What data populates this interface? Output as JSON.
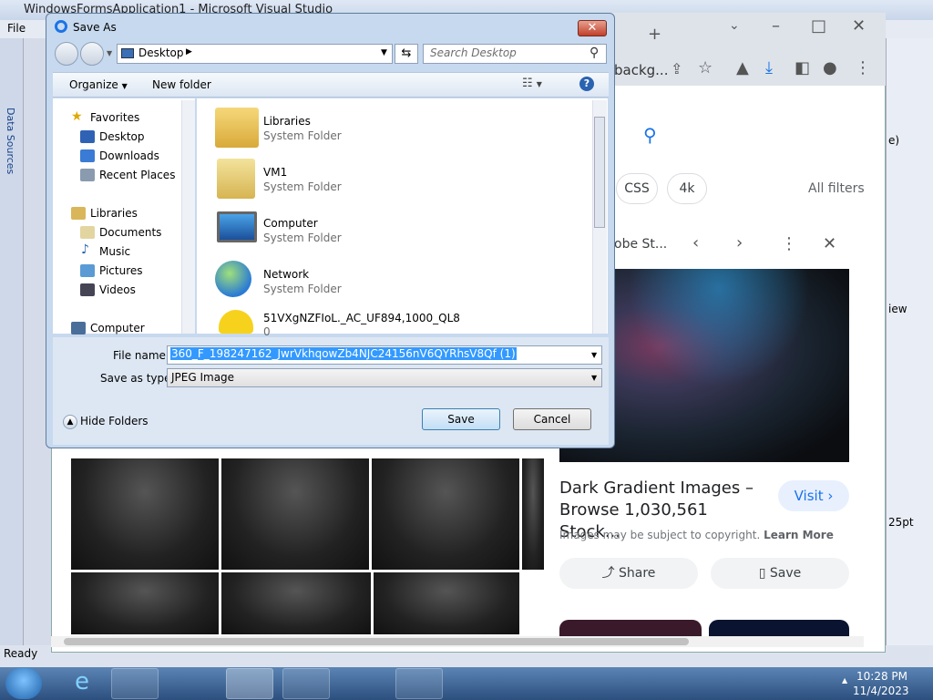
{
  "vs": {
    "title": "WindowsFormsApplication1 - Microsoft Visual Studio",
    "menu_file": "File",
    "data_sources": "Data Sources",
    "status": "Ready",
    "right_view": "iew",
    "right_pt": "25pt",
    "right_paren": "e)"
  },
  "chrome": {
    "tab_plus": "+",
    "addr_frag": "backg...",
    "chips": [
      "CSS",
      "4k"
    ],
    "all_filters": "All filters",
    "panel_source": "obe St...",
    "result_title": "Dark Gradient Images – Browse 1,030,561 Stock...",
    "copyright": "Images may be subject to copyright.",
    "learn_more": "Learn More",
    "visit": "Visit",
    "share": "Share",
    "save": "Save"
  },
  "dialog": {
    "title": "Save As",
    "address": "Desktop",
    "search_placeholder": "Search Desktop",
    "organize": "Organize",
    "new_folder": "New folder",
    "nav": {
      "favorites": "Favorites",
      "desktop": "Desktop",
      "downloads": "Downloads",
      "recent": "Recent Places",
      "libraries": "Libraries",
      "documents": "Documents",
      "music": "Music",
      "pictures": "Pictures",
      "videos": "Videos",
      "computer": "Computer"
    },
    "files": [
      {
        "name": "Libraries",
        "type": "System Folder"
      },
      {
        "name": "VM1",
        "type": "System Folder"
      },
      {
        "name": "Computer",
        "type": "System Folder"
      },
      {
        "name": "Network",
        "type": "System Folder"
      },
      {
        "name": "51VXgNZFIoL._AC_UF894,1000_QL8",
        "type": "0"
      }
    ],
    "file_name_label": "File name:",
    "file_name": "360_F_198247162_JwrVkhqowZb4NJC24156nV6QYRhsV8Qf (1)",
    "save_type_label": "Save as type:",
    "save_type": "JPEG Image",
    "hide_folders": "Hide Folders",
    "save": "Save",
    "cancel": "Cancel"
  },
  "taskbar": {
    "time": "10:28 PM",
    "date": "11/4/2023"
  }
}
